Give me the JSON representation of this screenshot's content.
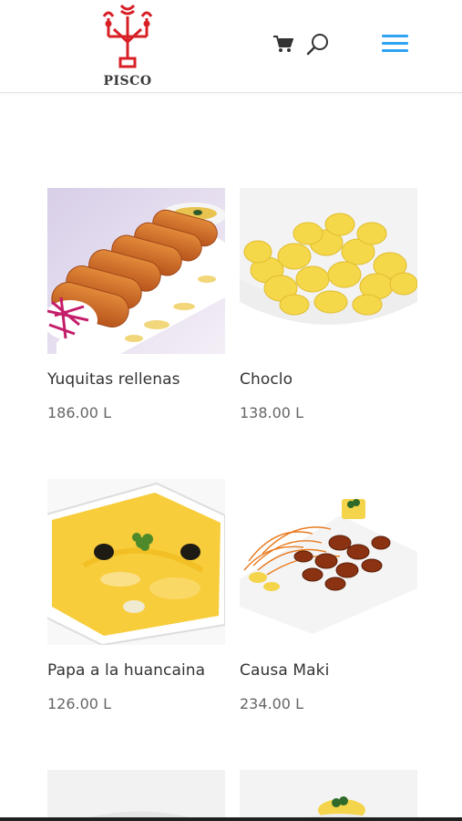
{
  "header": {
    "logo_text": "PISCO",
    "cart_icon": "cart-icon",
    "search_icon": "search-icon",
    "menu_icon": "hamburger-menu-icon",
    "menu_color": "#2ea3f2"
  },
  "products": [
    {
      "name": "Yuquitas rellenas",
      "price": "186.00 L"
    },
    {
      "name": "Choclo",
      "price": "138.00 L"
    },
    {
      "name": "Papa a la huancaina",
      "price": "126.00 L"
    },
    {
      "name": "Causa Maki",
      "price": "234.00 L"
    }
  ],
  "colors": {
    "logo_red": "#d81f26",
    "text_dark": "#333333",
    "text_price": "#666666"
  }
}
